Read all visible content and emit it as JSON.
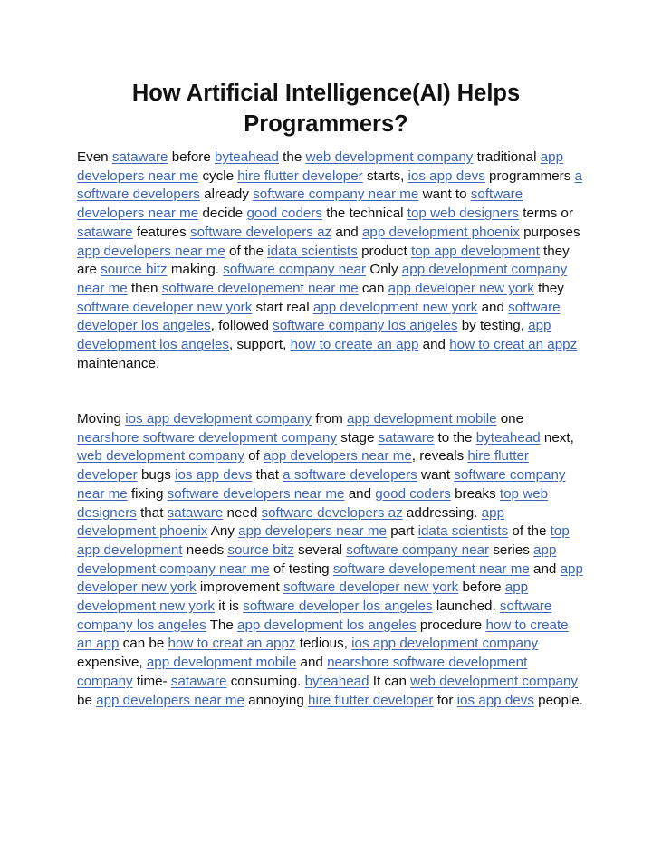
{
  "document": {
    "title": "How Artificial Intelligence(AI) Helps Programmers?",
    "link_color": "#3a64b8",
    "paragraphs": [
      [
        {
          "t": "Even "
        },
        {
          "l": "sataware"
        },
        {
          "t": " before "
        },
        {
          "l": "byteahead"
        },
        {
          "t": " the "
        },
        {
          "l": "web development company"
        },
        {
          "t": " traditional "
        },
        {
          "l": "app developers near me"
        },
        {
          "t": " cycle "
        },
        {
          "l": "hire flutter developer"
        },
        {
          "t": " starts, "
        },
        {
          "l": "ios app devs"
        },
        {
          "t": " programmers "
        },
        {
          "l": "a software developers"
        },
        {
          "t": " already "
        },
        {
          "l": "software company near me"
        },
        {
          "t": " want to "
        },
        {
          "l": "software developers near me"
        },
        {
          "t": " decide "
        },
        {
          "l": "good coders"
        },
        {
          "t": " the technical "
        },
        {
          "l": "top web designers"
        },
        {
          "t": " terms or "
        },
        {
          "l": "sataware"
        },
        {
          "t": " features "
        },
        {
          "l": "software developers az"
        },
        {
          "t": " and "
        },
        {
          "l": "app development phoenix"
        },
        {
          "t": " purposes "
        },
        {
          "l": "app developers near me"
        },
        {
          "t": " of the "
        },
        {
          "l": "idata scientists"
        },
        {
          "t": " product "
        },
        {
          "l": "top app development"
        },
        {
          "t": " they are "
        },
        {
          "l": "source bitz"
        },
        {
          "t": " making. "
        },
        {
          "l": "software company near"
        },
        {
          "t": " Only "
        },
        {
          "l": "app development company near me"
        },
        {
          "t": " then "
        },
        {
          "l": "software developement near me"
        },
        {
          "t": " can "
        },
        {
          "l": "app developer new york"
        },
        {
          "t": " they "
        },
        {
          "l": "software developer new york"
        },
        {
          "t": " start real "
        },
        {
          "l": "app development new york"
        },
        {
          "t": " and "
        },
        {
          "l": "software developer los angeles"
        },
        {
          "t": ", followed "
        },
        {
          "l": "software company los angeles"
        },
        {
          "t": " by testing, "
        },
        {
          "l": "app development los angeles"
        },
        {
          "t": ", support, "
        },
        {
          "l": "how to create an app"
        },
        {
          "t": " and "
        },
        {
          "l": "how to creat an appz"
        },
        {
          "t": " maintenance."
        }
      ],
      [
        {
          "t": "Moving "
        },
        {
          "l": "ios app development company"
        },
        {
          "t": " from "
        },
        {
          "l": "app development mobile"
        },
        {
          "t": " one "
        },
        {
          "l": "nearshore software development company"
        },
        {
          "t": " stage "
        },
        {
          "l": "sataware"
        },
        {
          "t": " to the "
        },
        {
          "l": "byteahead"
        },
        {
          "t": " next, "
        },
        {
          "l": "web development company"
        },
        {
          "t": " of "
        },
        {
          "l": "app developers near me"
        },
        {
          "t": ", reveals "
        },
        {
          "l": "hire flutter developer"
        },
        {
          "t": " bugs "
        },
        {
          "l": "ios app devs"
        },
        {
          "t": " that "
        },
        {
          "l": "a software developers"
        },
        {
          "t": " want "
        },
        {
          "l": "software company near me"
        },
        {
          "t": " fixing "
        },
        {
          "l": "software developers near me"
        },
        {
          "t": " and "
        },
        {
          "l": "good coders"
        },
        {
          "t": " breaks "
        },
        {
          "l": "top web designers"
        },
        {
          "t": " that "
        },
        {
          "l": "sataware"
        },
        {
          "t": " need "
        },
        {
          "l": "software developers az"
        },
        {
          "t": " addressing. "
        },
        {
          "l": "app development phoenix"
        },
        {
          "t": " Any "
        },
        {
          "l": "app developers near me"
        },
        {
          "t": " part "
        },
        {
          "l": "idata scientists"
        },
        {
          "t": " of the "
        },
        {
          "l": "top app development"
        },
        {
          "t": " needs "
        },
        {
          "l": "source bitz"
        },
        {
          "t": " several "
        },
        {
          "l": "software company near"
        },
        {
          "t": " series "
        },
        {
          "l": "app development company near me"
        },
        {
          "t": " of testing "
        },
        {
          "l": "software developement near me"
        },
        {
          "t": " and "
        },
        {
          "l": "app developer new york"
        },
        {
          "t": " improvement "
        },
        {
          "l": "software developer new york"
        },
        {
          "t": " before "
        },
        {
          "l": "app development new york"
        },
        {
          "t": " it is "
        },
        {
          "l": "software developer los angeles"
        },
        {
          "t": " launched. "
        },
        {
          "l": "software company los angeles"
        },
        {
          "t": " The "
        },
        {
          "l": "app development los angeles"
        },
        {
          "t": " procedure "
        },
        {
          "l": "how to create an app"
        },
        {
          "t": " can be "
        },
        {
          "l": "how to creat an appz"
        },
        {
          "t": " tedious, "
        },
        {
          "l": "ios app development company"
        },
        {
          "t": " expensive, "
        },
        {
          "l": "app development mobile"
        },
        {
          "t": " and "
        },
        {
          "l": "nearshore software development company"
        },
        {
          "t": " time- "
        },
        {
          "l": "sataware"
        },
        {
          "t": " consuming. "
        },
        {
          "l": "byteahead"
        },
        {
          "t": " It can "
        },
        {
          "l": "web development company"
        },
        {
          "t": " be "
        },
        {
          "l": "app developers near me"
        },
        {
          "t": " annoying "
        },
        {
          "l": "hire flutter developer"
        },
        {
          "t": " for "
        },
        {
          "l": "ios app devs"
        },
        {
          "t": " people."
        }
      ]
    ]
  }
}
